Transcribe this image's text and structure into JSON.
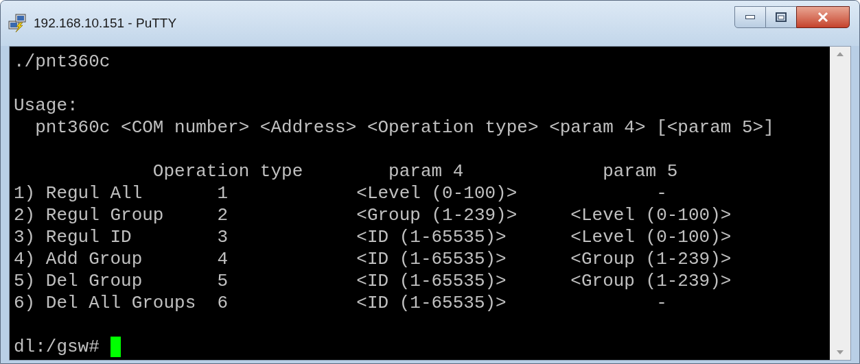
{
  "window": {
    "title": "192.168.10.151 - PuTTY"
  },
  "terminal": {
    "lines": [
      {
        "kind": "text",
        "text": "./pnt360c"
      },
      {
        "kind": "blank"
      },
      {
        "kind": "text",
        "text": "Usage:"
      },
      {
        "kind": "text",
        "text": "  pnt360c <COM number> <Address> <Operation type> <param 4> [<param 5>]"
      },
      {
        "kind": "blank"
      },
      {
        "kind": "text",
        "text": "             Operation type        param 4             param 5"
      },
      {
        "kind": "text",
        "text": "1) Regul All       1            <Level (0-100)>             -"
      },
      {
        "kind": "text",
        "text": "2) Regul Group     2            <Group (1-239)>     <Level (0-100)>"
      },
      {
        "kind": "text",
        "text": "3) Regul ID        3            <ID (1-65535)>      <Level (0-100)>"
      },
      {
        "kind": "text",
        "text": "4) Add Group       4            <ID (1-65535)>      <Group (1-239)>"
      },
      {
        "kind": "text",
        "text": "5) Del Group       5            <ID (1-65535)>      <Group (1-239)>"
      },
      {
        "kind": "text",
        "text": "6) Del All Groups  6            <ID (1-65535)>              -"
      },
      {
        "kind": "blank"
      },
      {
        "kind": "prompt",
        "text": "dl:/gsw#",
        "cursor": true
      }
    ]
  }
}
